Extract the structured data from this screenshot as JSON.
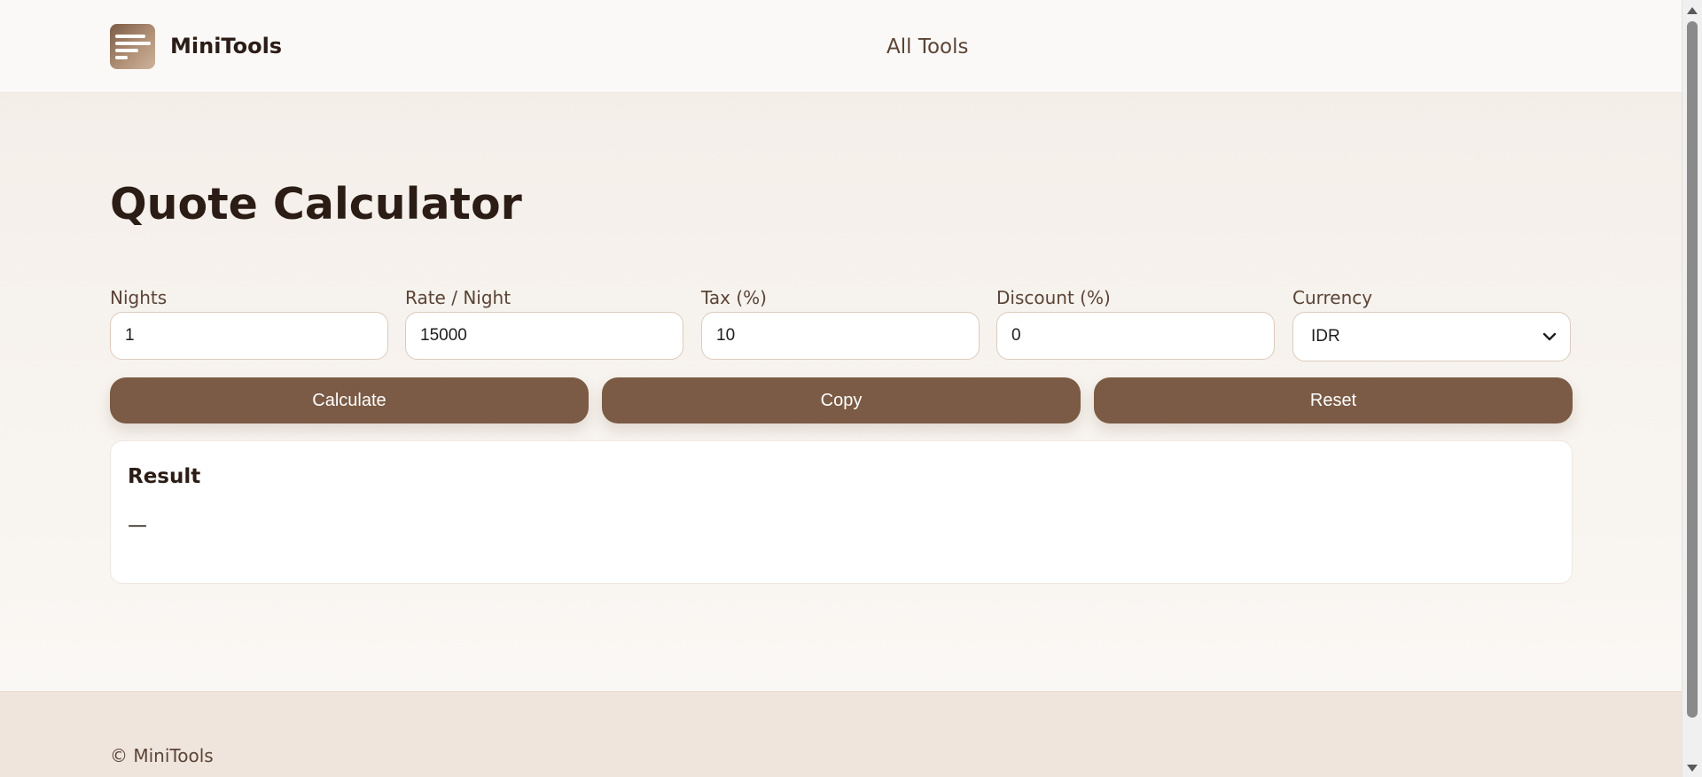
{
  "header": {
    "brand": "MiniTools",
    "logo_icon": "document-lines-icon",
    "nav_all_tools": "All Tools"
  },
  "main": {
    "title": "Quote Calculator",
    "fields": {
      "nights": {
        "label": "Nights",
        "value": "1"
      },
      "rate": {
        "label": "Rate / Night",
        "value": "15000"
      },
      "tax": {
        "label": "Tax (%)",
        "value": "10"
      },
      "discount": {
        "label": "Discount (%)",
        "value": "0"
      },
      "currency": {
        "label": "Currency",
        "selected": "IDR"
      }
    },
    "buttons": {
      "calculate": "Calculate",
      "copy": "Copy",
      "reset": "Reset"
    },
    "result": {
      "title": "Result",
      "value": "—"
    }
  },
  "footer": {
    "text": "© MiniTools"
  },
  "colors": {
    "accent": "#7b5b45",
    "text": "#2b1d16",
    "background": "#f3ede7"
  }
}
